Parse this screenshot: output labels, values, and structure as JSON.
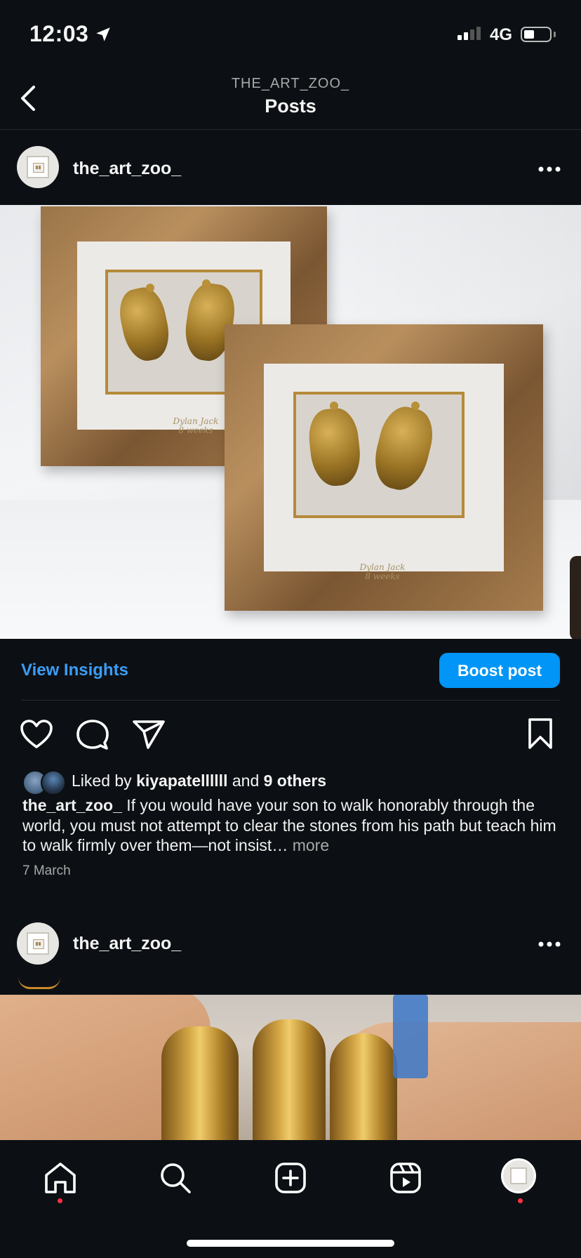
{
  "status_bar": {
    "time": "12:03",
    "network": "4G"
  },
  "header": {
    "account": "THE_ART_ZOO_",
    "title": "Posts"
  },
  "post1": {
    "username": "the_art_zoo_",
    "image_text_left": "Dylan Jack\n8 weeks",
    "image_text_right": "Dylan Jack\n8 weeks",
    "view_insights": "View Insights",
    "boost_post": "Boost post",
    "liked_prefix": "Liked by",
    "liked_user": "kiyapatellllll",
    "liked_and": "and",
    "liked_others": "9 others",
    "caption_user": "the_art_zoo_",
    "caption_text": "If you would have your son to walk honorably through the world, you must not attempt to clear the stones from his path but teach him to walk firmly over them—not insist…",
    "caption_more": "more",
    "date": "7 March"
  },
  "post2": {
    "username": "the_art_zoo_"
  },
  "icons": {
    "location": "location-arrow-icon",
    "back": "chevron-left-icon",
    "more": "more-horizontal-icon",
    "like": "heart-icon",
    "comment": "comment-icon",
    "share": "paper-plane-icon",
    "save": "bookmark-icon",
    "home": "home-icon",
    "search": "search-icon",
    "create": "plus-square-icon",
    "reels": "reels-icon",
    "profile": "profile-avatar"
  },
  "colors": {
    "accent": "#0095f6",
    "link": "#3b9df8",
    "background": "#0c1014",
    "notification": "#ff3040"
  }
}
